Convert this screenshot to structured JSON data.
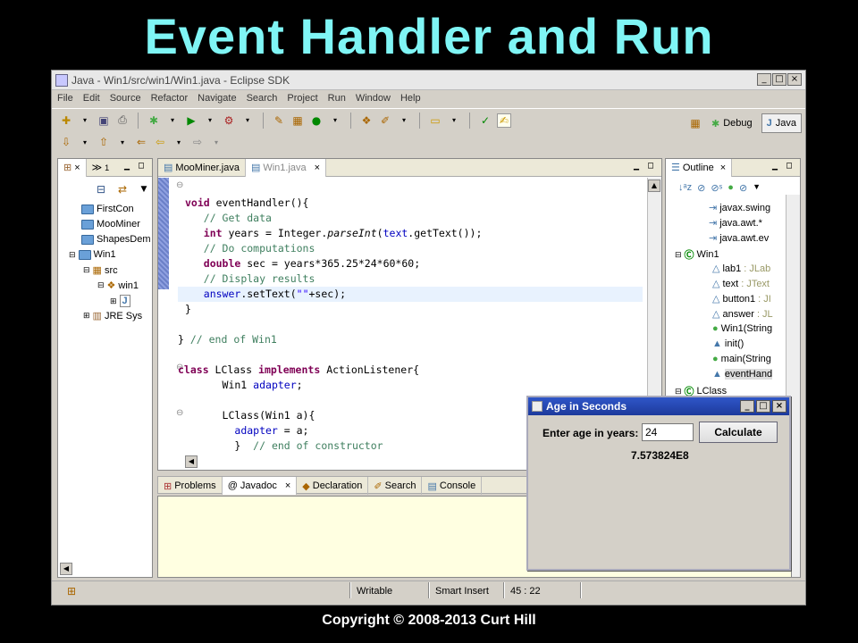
{
  "slide": {
    "title": "Event Handler and Run",
    "copyright": "Copyright © 2008-2013 Curt Hill"
  },
  "window": {
    "title": "Java - Win1/src/win1/Win1.java - Eclipse SDK",
    "buttons": [
      "_",
      "□",
      "×"
    ]
  },
  "menu": [
    "File",
    "Edit",
    "Source",
    "Refactor",
    "Navigate",
    "Search",
    "Project",
    "Run",
    "Window",
    "Help"
  ],
  "perspectives": {
    "debug": "Debug",
    "java": "Java"
  },
  "explorer": {
    "tab_badge": "1",
    "items": [
      {
        "label": "FirstCon"
      },
      {
        "label": "MooMiner"
      },
      {
        "label": "ShapesDem"
      },
      {
        "label": "Win1"
      },
      {
        "label": "src"
      },
      {
        "label": "win1"
      },
      {
        "label": "J"
      },
      {
        "label": "JRE Sys"
      }
    ]
  },
  "editor": {
    "tabs": [
      {
        "label": "MooMiner.java"
      },
      {
        "label": "Win1.java"
      }
    ],
    "code_lines": [
      "void eventHandler(){",
      "   // Get data",
      "   int years = Integer.parseInt(text.getText());",
      "   // Do computations",
      "   double sec = years*365.25*24*60*60;",
      "   // Display results",
      "   answer.setText(\"\"+sec);",
      "}",
      "",
      "} // end of Win1",
      "",
      "class LClass implements ActionListener{",
      "      Win1 adapter;",
      "",
      "      LClass(Win1 a){",
      "        adapter = a;",
      "        }  // end of constructor"
    ]
  },
  "outline": {
    "tab": "Outline",
    "items": [
      {
        "label": "javax.swing"
      },
      {
        "label": "java.awt.*"
      },
      {
        "label": "java.awt.ev"
      },
      {
        "label": "Win1"
      },
      {
        "label": "lab1",
        "type": " : JLab"
      },
      {
        "label": "text",
        "type": " : JText"
      },
      {
        "label": "button1",
        "type": " : JI"
      },
      {
        "label": "answer",
        "type": " : JL"
      },
      {
        "label": "Win1(String"
      },
      {
        "label": "init()"
      },
      {
        "label": "main(String"
      },
      {
        "label": "eventHand"
      },
      {
        "label": "LClass"
      }
    ]
  },
  "bottom_tabs": [
    {
      "label": "Problems"
    },
    {
      "label": "Javadoc"
    },
    {
      "label": "Declaration"
    },
    {
      "label": "Search"
    },
    {
      "label": "Console"
    }
  ],
  "status": {
    "writable": "Writable",
    "insert": "Smart Insert",
    "position": "45 : 22"
  },
  "dialog": {
    "title": "Age in Seconds",
    "label": "Enter age in years:",
    "input_value": "24",
    "button": "Calculate",
    "result": "7.573824E8"
  }
}
